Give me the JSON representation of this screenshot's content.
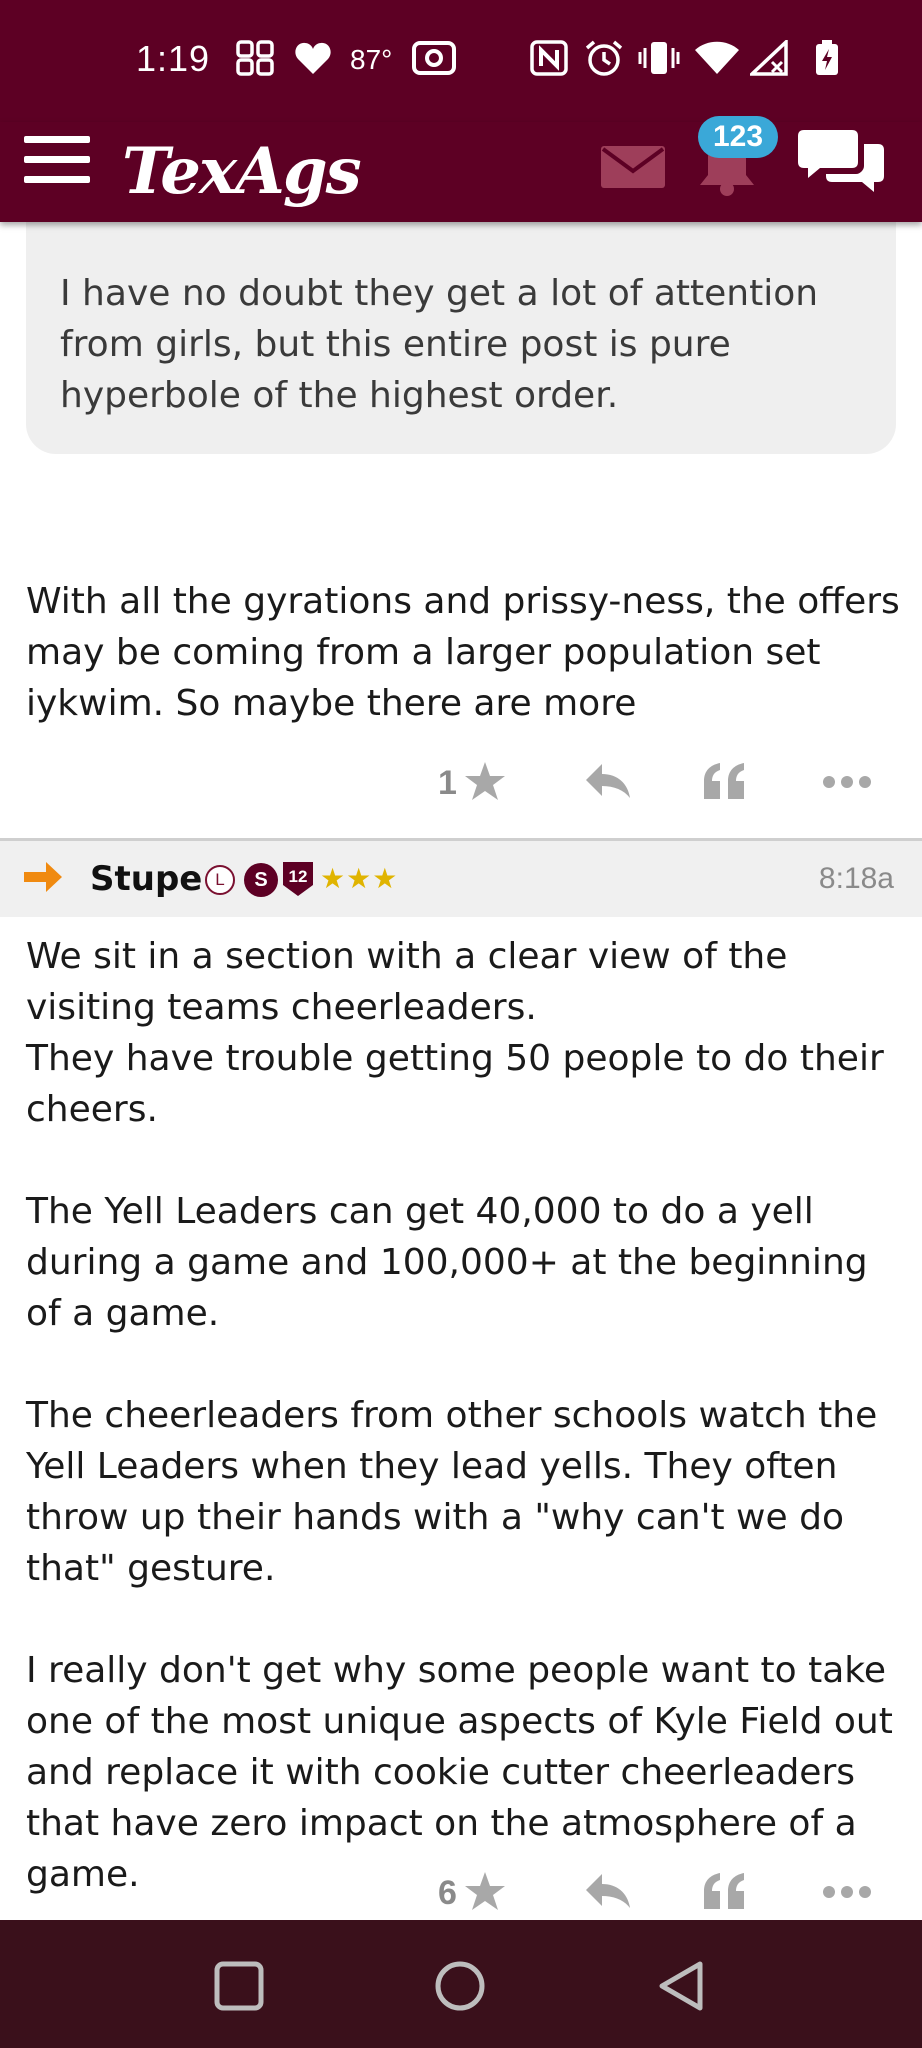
{
  "status_bar": {
    "time": "1:19",
    "temperature": "87°",
    "icons": [
      "grid-widget-icon",
      "heart-icon",
      "camera-icon",
      "nfc-icon",
      "alarm-icon",
      "vibrate-icon",
      "wifi-icon",
      "signal-icon",
      "battery-charging-icon"
    ]
  },
  "app_bar": {
    "logo": "TexAgs",
    "notification_count": "123",
    "icons": [
      "menu-icon",
      "mail-icon",
      "bell-icon",
      "chat-icon"
    ]
  },
  "posts": [
    {
      "quote": "I have no doubt they get a lot of attention from girls, but this entire post is pure hyperbole of the highest order.",
      "body": "With all the gyrations and prissy-ness, the offers may be coming from a larger population set iykwim. So maybe there are more",
      "star_count": "1"
    },
    {
      "author": "Stupe",
      "badges": {
        "l": "L",
        "s": "S",
        "twelve": "12"
      },
      "stars": "★★★",
      "time": "8:18a",
      "body": "We sit in a section with a clear view of the visiting teams cheerleaders.\nThey have trouble getting 50 people to do their cheers.\n\nThe Yell Leaders can get 40,000 to do a yell during a game and 100,000+ at the beginning of a game.\n\nThe cheerleaders from other schools watch the Yell Leaders when they lead yells. They often throw up their hands with a \"why can't we do that\" gesture.\n\nI really don't get why some people want to take one of the most unique aspects of Kyle Field out and replace it with cookie cutter cheerleaders that have zero impact on the atmosphere of a game.",
      "star_count": "6"
    }
  ],
  "colors": {
    "brand_maroon": "#5d0024",
    "badge_blue": "#3aa8d8",
    "nav_bar": "#3a101b",
    "star_gold": "#e0b400",
    "arrow_orange": "#f08a10"
  }
}
